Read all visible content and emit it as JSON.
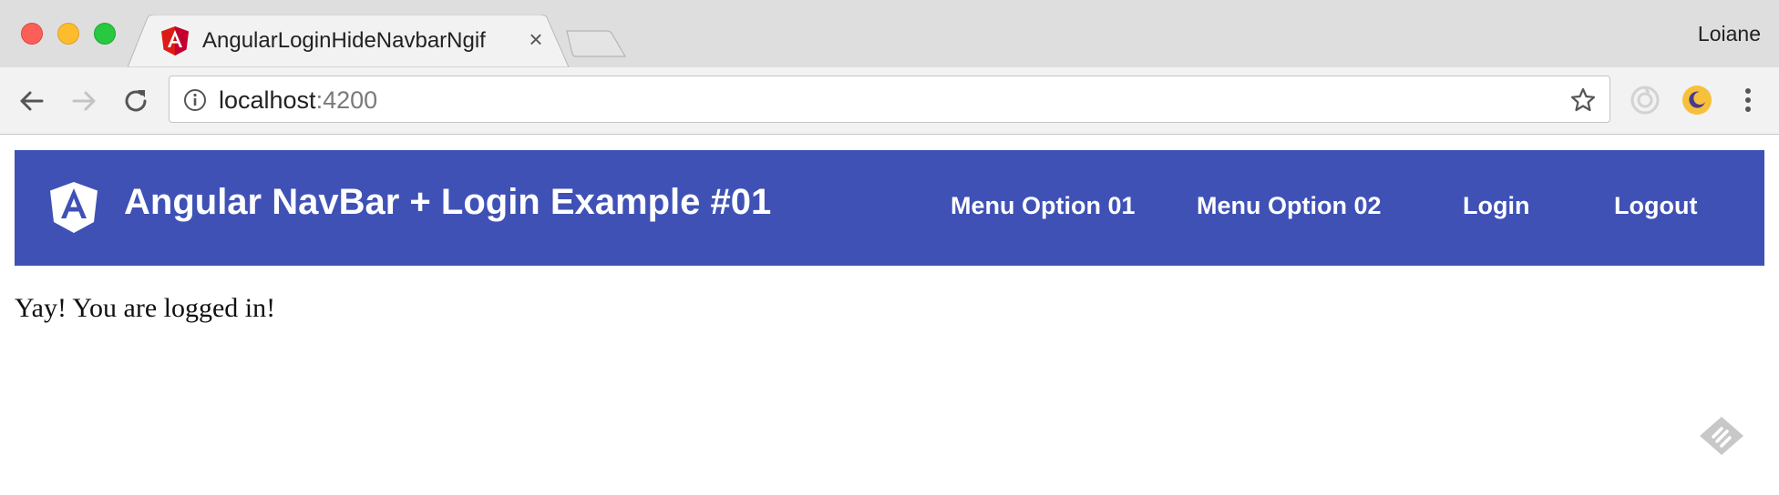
{
  "browser": {
    "tab": {
      "title": "AngularLoginHideNavbarNgif",
      "close_glyph": "×"
    },
    "profile_name": "Loiane",
    "address_bar": {
      "host": "localhost",
      "port": ":4200"
    },
    "icons": [
      "back-arrow-icon",
      "forward-arrow-icon",
      "reload-icon",
      "info-icon",
      "bookmark-star-icon",
      "extension-icon",
      "night-mode-extension-icon",
      "more-menu-icon"
    ]
  },
  "app": {
    "brand": {
      "title": "Angular NavBar + Login Example #01",
      "logo": "angular-logo-icon"
    },
    "menu": [
      {
        "label": "Menu Option 01"
      },
      {
        "label": "Menu Option 02"
      },
      {
        "label": "Login"
      },
      {
        "label": "Logout"
      }
    ],
    "message": "Yay! You are logged in!"
  },
  "colors": {
    "navbar": "#3f51b5",
    "angular_red": "#dd1b16",
    "tab_background": "#f2f2f2",
    "titlebar": "#dedede"
  }
}
